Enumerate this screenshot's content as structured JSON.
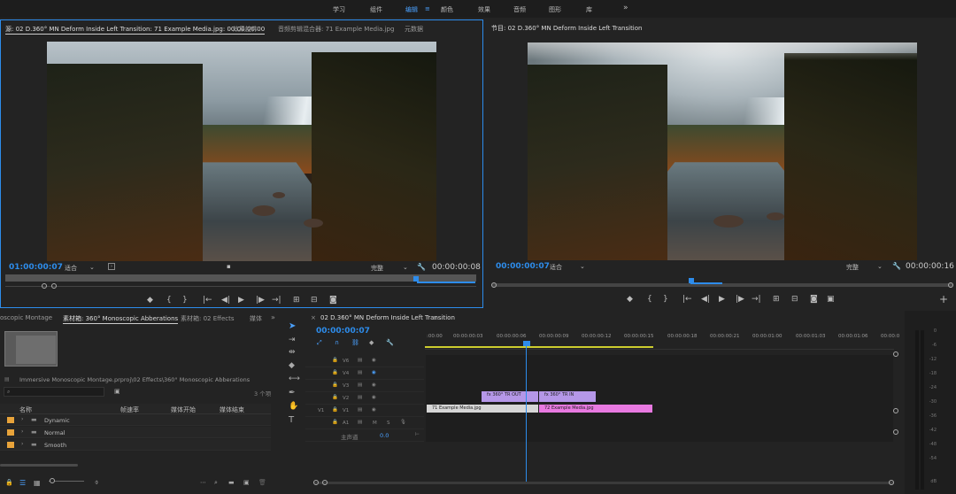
{
  "workspaces": [
    {
      "label": "学习",
      "active": false
    },
    {
      "label": "组件",
      "active": false
    },
    {
      "label": "编辑",
      "active": true
    },
    {
      "label": "颜色",
      "active": false
    },
    {
      "label": "效果",
      "active": false
    },
    {
      "label": "音频",
      "active": false
    },
    {
      "label": "图形",
      "active": false
    },
    {
      "label": "库",
      "active": false
    }
  ],
  "overflow_icon": "»",
  "source_panel": {
    "tabs": [
      "源: 02 D.360° MN Deform Inside Left Transition: 71 Example Media.jpg: 00:00:00:00",
      "效果控件",
      "音频剪辑混合器: 71 Example Media.jpg",
      "元数据"
    ],
    "timecode": "01:00:00:07",
    "fit": "适合",
    "quality": "完整",
    "duration": "00:00:00:08"
  },
  "program_panel": {
    "tab": "节目: 02 D.360° MN Deform Inside Left Transition",
    "timecode": "00:00:00:07",
    "fit": "适合",
    "quality": "完整",
    "duration": "00:00:00:16"
  },
  "project_panel": {
    "tabs": [
      "oscopic Montage",
      "素材箱: 360° Monoscopic Abberations",
      "素材箱: 02 Effects",
      "媒体"
    ],
    "path": "Immersive Monoscopic Montage.prproj\\02 Effects\\360° Monoscopic Abberations",
    "count": "3 个项",
    "columns": [
      "名称",
      "帧速率",
      "媒体开始",
      "媒体结束"
    ],
    "items": [
      "Dynamic",
      "Normal",
      "Smooth"
    ],
    "folder_color": "#e8a33a"
  },
  "timeline": {
    "tab": "02 D.360° MN Deform Inside Left Transition",
    "timecode": "00:00:00:07",
    "ticks": [
      ":00:00",
      "00:00:00:03",
      "00:00:00:06",
      "00:00:00:09",
      "00:00:00:12",
      "00:00:00:15",
      "00:00:00:18",
      "00:00:00:21",
      "00:00:01:00",
      "00:00:01:03",
      "00:00:01:06",
      "00:00:0"
    ],
    "tracks": [
      {
        "name": "V6"
      },
      {
        "name": "V4"
      },
      {
        "name": "V3"
      },
      {
        "name": "V2"
      },
      {
        "name": "V1",
        "src": "V1"
      },
      {
        "name": "A1",
        "mute": "M",
        "solo": "S"
      }
    ],
    "master_label": "主声道",
    "master_value": "0.0",
    "clips": {
      "tr_out": "360° TR OUT",
      "tr_in": "360° TR IN",
      "v1_a": "71 Example Media.jpg",
      "v1_b": "72 Example Media.jpg"
    },
    "colors": {
      "adjust": "#b597e8",
      "media": "#d6d6d6",
      "media2": "#e879e0",
      "playhead": "#2d8ceb",
      "workarea": "#cdcd2e"
    }
  },
  "meter": {
    "ticks": [
      "0",
      "-6",
      "-12",
      "-18",
      "-24",
      "-30",
      "-36",
      "-42",
      "-48",
      "-54"
    ],
    "unit": "dB"
  }
}
